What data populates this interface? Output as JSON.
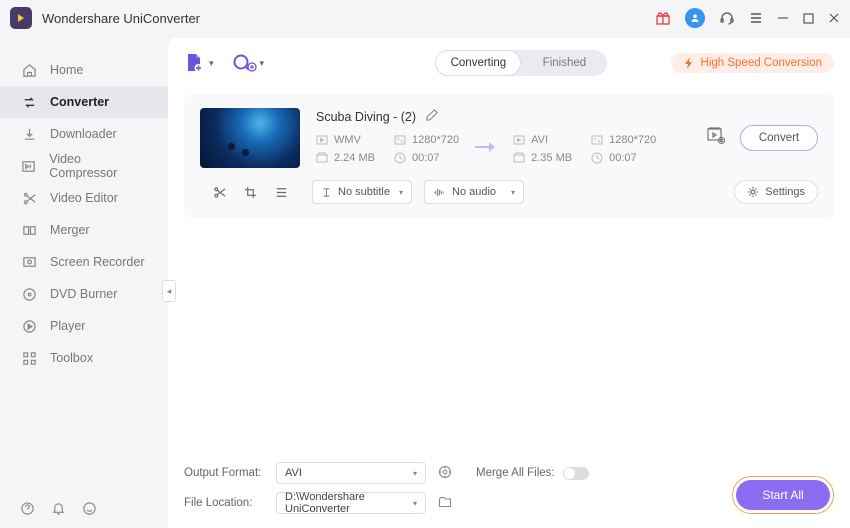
{
  "titlebar": {
    "app_name": "Wondershare UniConverter"
  },
  "sidebar": {
    "items": [
      {
        "label": "Home"
      },
      {
        "label": "Converter"
      },
      {
        "label": "Downloader"
      },
      {
        "label": "Video Compressor"
      },
      {
        "label": "Video Editor"
      },
      {
        "label": "Merger"
      },
      {
        "label": "Screen Recorder"
      },
      {
        "label": "DVD Burner"
      },
      {
        "label": "Player"
      },
      {
        "label": "Toolbox"
      }
    ]
  },
  "toolbar": {
    "tabs": {
      "converting": "Converting",
      "finished": "Finished"
    },
    "high_speed": "High Speed Conversion"
  },
  "file": {
    "name": "Scuba Diving - (2)",
    "src": {
      "format": "WMV",
      "resolution": "1280*720",
      "size": "2.24 MB",
      "duration": "00:07"
    },
    "dst": {
      "format": "AVI",
      "resolution": "1280*720",
      "size": "2.35 MB",
      "duration": "00:07"
    },
    "subtitle": "No subtitle",
    "audio": "No audio",
    "convert_label": "Convert",
    "settings_label": "Settings"
  },
  "bottom": {
    "output_format_label": "Output Format:",
    "output_format_value": "AVI",
    "file_location_label": "File Location:",
    "file_location_value": "D:\\Wondershare UniConverter",
    "merge_label": "Merge All Files:",
    "start_all": "Start All"
  }
}
